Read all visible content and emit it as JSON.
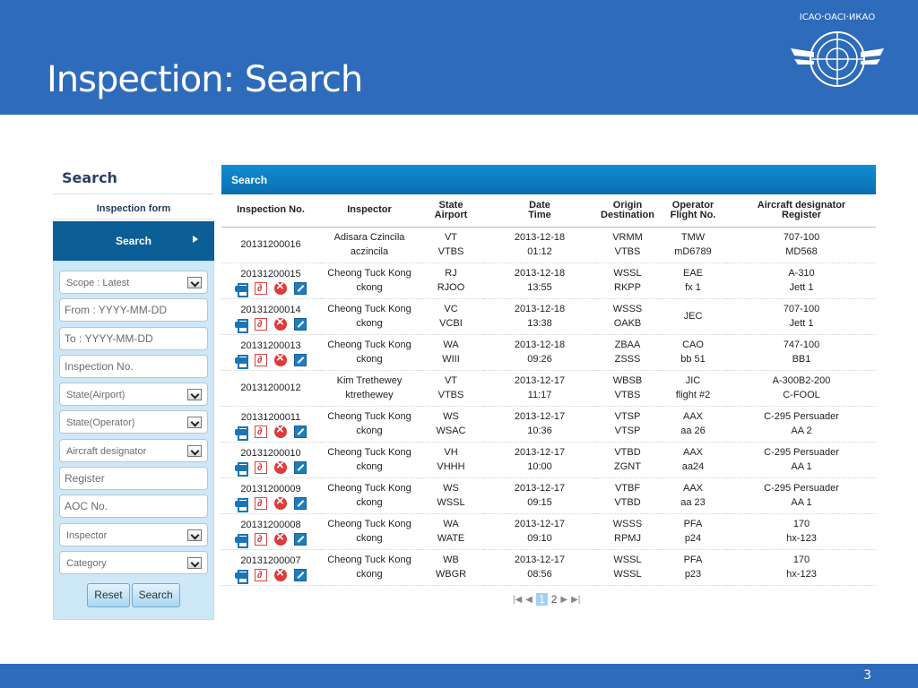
{
  "slide": {
    "title": "Inspection: Search",
    "page_number": "3",
    "logo": "icao-logo",
    "header_color": "#2e6bba"
  },
  "sidebar": {
    "title": "Search",
    "form_label": "Inspection form",
    "active_item": "Search",
    "fields": [
      {
        "type": "select",
        "text": "Scope : Latest"
      },
      {
        "type": "input",
        "text": "From : YYYY-MM-DD"
      },
      {
        "type": "input",
        "text": "To : YYYY-MM-DD"
      },
      {
        "type": "input",
        "text": "Inspection No."
      },
      {
        "type": "select",
        "text": "State(Airport)"
      },
      {
        "type": "select",
        "text": "State(Operator)"
      },
      {
        "type": "select",
        "text": "Aircraft designator"
      },
      {
        "type": "input",
        "text": "Register"
      },
      {
        "type": "input",
        "text": "AOC No."
      },
      {
        "type": "select",
        "text": "Inspector"
      },
      {
        "type": "select",
        "text": "Category"
      }
    ],
    "reset_label": "Reset",
    "search_label": "Search"
  },
  "results": {
    "title": "Search",
    "columns": [
      {
        "l1": "Inspection No.",
        "l2": ""
      },
      {
        "l1": "Inspector",
        "l2": ""
      },
      {
        "l1": "State",
        "l2": "Airport"
      },
      {
        "l1": "Date",
        "l2": "Time"
      },
      {
        "l1": "Origin",
        "l2": "Destination"
      },
      {
        "l1": "Operator",
        "l2": "Flight No."
      },
      {
        "l1": "Aircraft designator",
        "l2": "Register"
      }
    ],
    "rows": [
      {
        "no": "20131200016",
        "actions": false,
        "inspector": [
          "Adisara Czincila",
          "aczincila"
        ],
        "state": [
          "VT",
          "VTBS"
        ],
        "dt": [
          "2013-12-18",
          "01:12"
        ],
        "od": [
          "VRMM",
          "VTBS"
        ],
        "op": [
          "TMW",
          "mD6789"
        ],
        "ac": [
          "707-100",
          "MD568"
        ]
      },
      {
        "no": "20131200015",
        "actions": true,
        "inspector": [
          "Cheong Tuck Kong",
          "ckong"
        ],
        "state": [
          "RJ",
          "RJOO"
        ],
        "dt": [
          "2013-12-18",
          "13:55"
        ],
        "od": [
          "WSSL",
          "RKPP"
        ],
        "op": [
          "EAE",
          "fx 1"
        ],
        "ac": [
          "A-310",
          "Jett 1"
        ]
      },
      {
        "no": "20131200014",
        "actions": true,
        "inspector": [
          "Cheong Tuck Kong",
          "ckong"
        ],
        "state": [
          "VC",
          "VCBI"
        ],
        "dt": [
          "2013-12-18",
          "13:38"
        ],
        "od": [
          "WSSS",
          "OAKB"
        ],
        "op": [
          "JEC",
          ""
        ],
        "ac": [
          "707-100",
          "Jett 1"
        ]
      },
      {
        "no": "20131200013",
        "actions": true,
        "inspector": [
          "Cheong Tuck Kong",
          "ckong"
        ],
        "state": [
          "WA",
          "WIII"
        ],
        "dt": [
          "2013-12-18",
          "09:26"
        ],
        "od": [
          "ZBAA",
          "ZSSS"
        ],
        "op": [
          "CAO",
          "bb 51"
        ],
        "ac": [
          "747-100",
          "BB1"
        ]
      },
      {
        "no": "20131200012",
        "actions": false,
        "inspector": [
          "Kim Trethewey",
          "ktrethewey"
        ],
        "state": [
          "VT",
          "VTBS"
        ],
        "dt": [
          "2013-12-17",
          "11:17"
        ],
        "od": [
          "WBSB",
          "VTBS"
        ],
        "op": [
          "JIC",
          "flight #2"
        ],
        "ac": [
          "A-300B2-200",
          "C-FOOL"
        ]
      },
      {
        "no": "20131200011",
        "actions": true,
        "inspector": [
          "Cheong Tuck Kong",
          "ckong"
        ],
        "state": [
          "WS",
          "WSAC"
        ],
        "dt": [
          "2013-12-17",
          "10:36"
        ],
        "od": [
          "VTSP",
          "VTSP"
        ],
        "op": [
          "AAX",
          "aa 26"
        ],
        "ac": [
          "C-295 Persuader",
          "AA 2"
        ]
      },
      {
        "no": "20131200010",
        "actions": true,
        "inspector": [
          "Cheong Tuck Kong",
          "ckong"
        ],
        "state": [
          "VH",
          "VHHH"
        ],
        "dt": [
          "2013-12-17",
          "10:00"
        ],
        "od": [
          "VTBD",
          "ZGNT"
        ],
        "op": [
          "AAX",
          "aa24"
        ],
        "ac": [
          "C-295 Persuader",
          "AA 1"
        ]
      },
      {
        "no": "20131200009",
        "actions": true,
        "inspector": [
          "Cheong Tuck Kong",
          "ckong"
        ],
        "state": [
          "WS",
          "WSSL"
        ],
        "dt": [
          "2013-12-17",
          "09:15"
        ],
        "od": [
          "VTBF",
          "VTBD"
        ],
        "op": [
          "AAX",
          "aa 23"
        ],
        "ac": [
          "C-295 Persuader",
          "AA 1"
        ]
      },
      {
        "no": "20131200008",
        "actions": true,
        "inspector": [
          "Cheong Tuck Kong",
          "ckong"
        ],
        "state": [
          "WA",
          "WATE"
        ],
        "dt": [
          "2013-12-17",
          "09:10"
        ],
        "od": [
          "WSSS",
          "RPMJ"
        ],
        "op": [
          "PFA",
          "p24"
        ],
        "ac": [
          "170",
          "hx-123"
        ]
      },
      {
        "no": "20131200007",
        "actions": true,
        "inspector": [
          "Cheong Tuck Kong",
          "ckong"
        ],
        "state": [
          "WB",
          "WBGR"
        ],
        "dt": [
          "2013-12-17",
          "08:56"
        ],
        "od": [
          "WSSL",
          "WSSL"
        ],
        "op": [
          "PFA",
          "p23"
        ],
        "ac": [
          "170",
          "hx-123"
        ]
      }
    ],
    "action_icons": [
      "print-icon",
      "pdf-icon",
      "delete-icon",
      "edit-icon"
    ]
  },
  "pagination": {
    "current_page": "1",
    "pages": [
      "1",
      "2"
    ]
  }
}
